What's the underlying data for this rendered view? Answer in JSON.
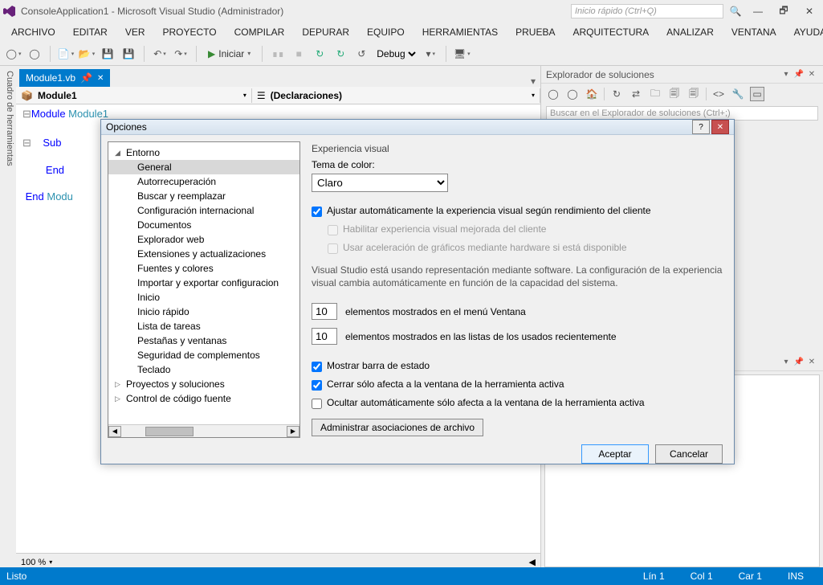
{
  "window": {
    "title": "ConsoleApplication1 - Microsoft Visual Studio (Administrador)",
    "quickstart_placeholder": "Inicio rápido (Ctrl+Q)"
  },
  "menu": [
    "ARCHIVO",
    "EDITAR",
    "VER",
    "PROYECTO",
    "COMPILAR",
    "DEPURAR",
    "EQUIPO",
    "HERRAMIENTAS",
    "PRUEBA",
    "ARQUITECTURA",
    "ANALIZAR",
    "VENTANA",
    "AYUDA"
  ],
  "toolbar": {
    "start": "Iniciar",
    "config": "Debug"
  },
  "sidetab": "Cuadro de herramientas",
  "doc": {
    "tab": "Module1.vb",
    "nav_left": "Module1",
    "nav_right": "(Declaraciones)"
  },
  "code": {
    "l1a": "Module",
    "l1b": " Module1",
    "l2": "    Sub",
    "l3": "    End",
    "l4a": "End ",
    "l4b": "Modu"
  },
  "zoom": "100 %",
  "solution": {
    "title": "Explorador de soluciones",
    "search_placeholder": "Buscar en el Explorador de soluciones (Ctrl+;)"
  },
  "status": {
    "ready": "Listo",
    "ln": "Lín 1",
    "col": "Col 1",
    "car": "Car 1",
    "ins": "INS"
  },
  "dialog": {
    "title": "Opciones",
    "tree_root": "Entorno",
    "tree_items": [
      "General",
      "Autorrecuperación",
      "Buscar y reemplazar",
      "Configuración internacional",
      "Documentos",
      "Explorador web",
      "Extensiones y actualizaciones",
      "Fuentes y colores",
      "Importar y exportar configuracion",
      "Inicio",
      "Inicio rápido",
      "Lista de tareas",
      "Pestañas y ventanas",
      "Seguridad de complementos",
      "Teclado"
    ],
    "tree_more": [
      "Proyectos y soluciones",
      "Control de código fuente"
    ],
    "group1": "Experiencia visual",
    "theme_label": "Tema de color:",
    "theme_value": "Claro",
    "chk_auto": "Ajustar automáticamente la experiencia visual según rendimiento del cliente",
    "chk_enhanced": "Habilitar experiencia visual mejorada del cliente",
    "chk_hw": "Usar aceleración de gráficos mediante hardware si está disponible",
    "note": "Visual Studio está usando representación mediante software. La configuración de la experiencia visual cambia automáticamente en función de la capacidad del sistema.",
    "win_count": "10",
    "win_label": "elementos mostrados en el menú Ventana",
    "mru_count": "10",
    "mru_label": "elementos mostrados en las listas de los usados recientemente",
    "chk_status": "Mostrar barra de estado",
    "chk_close": "Cerrar sólo afecta a la ventana de la herramienta activa",
    "chk_autohide": "Ocultar automáticamente sólo afecta a la ventana de la herramienta activa",
    "btn_assoc": "Administrar asociaciones de archivo",
    "btn_ok": "Aceptar",
    "btn_cancel": "Cancelar"
  }
}
